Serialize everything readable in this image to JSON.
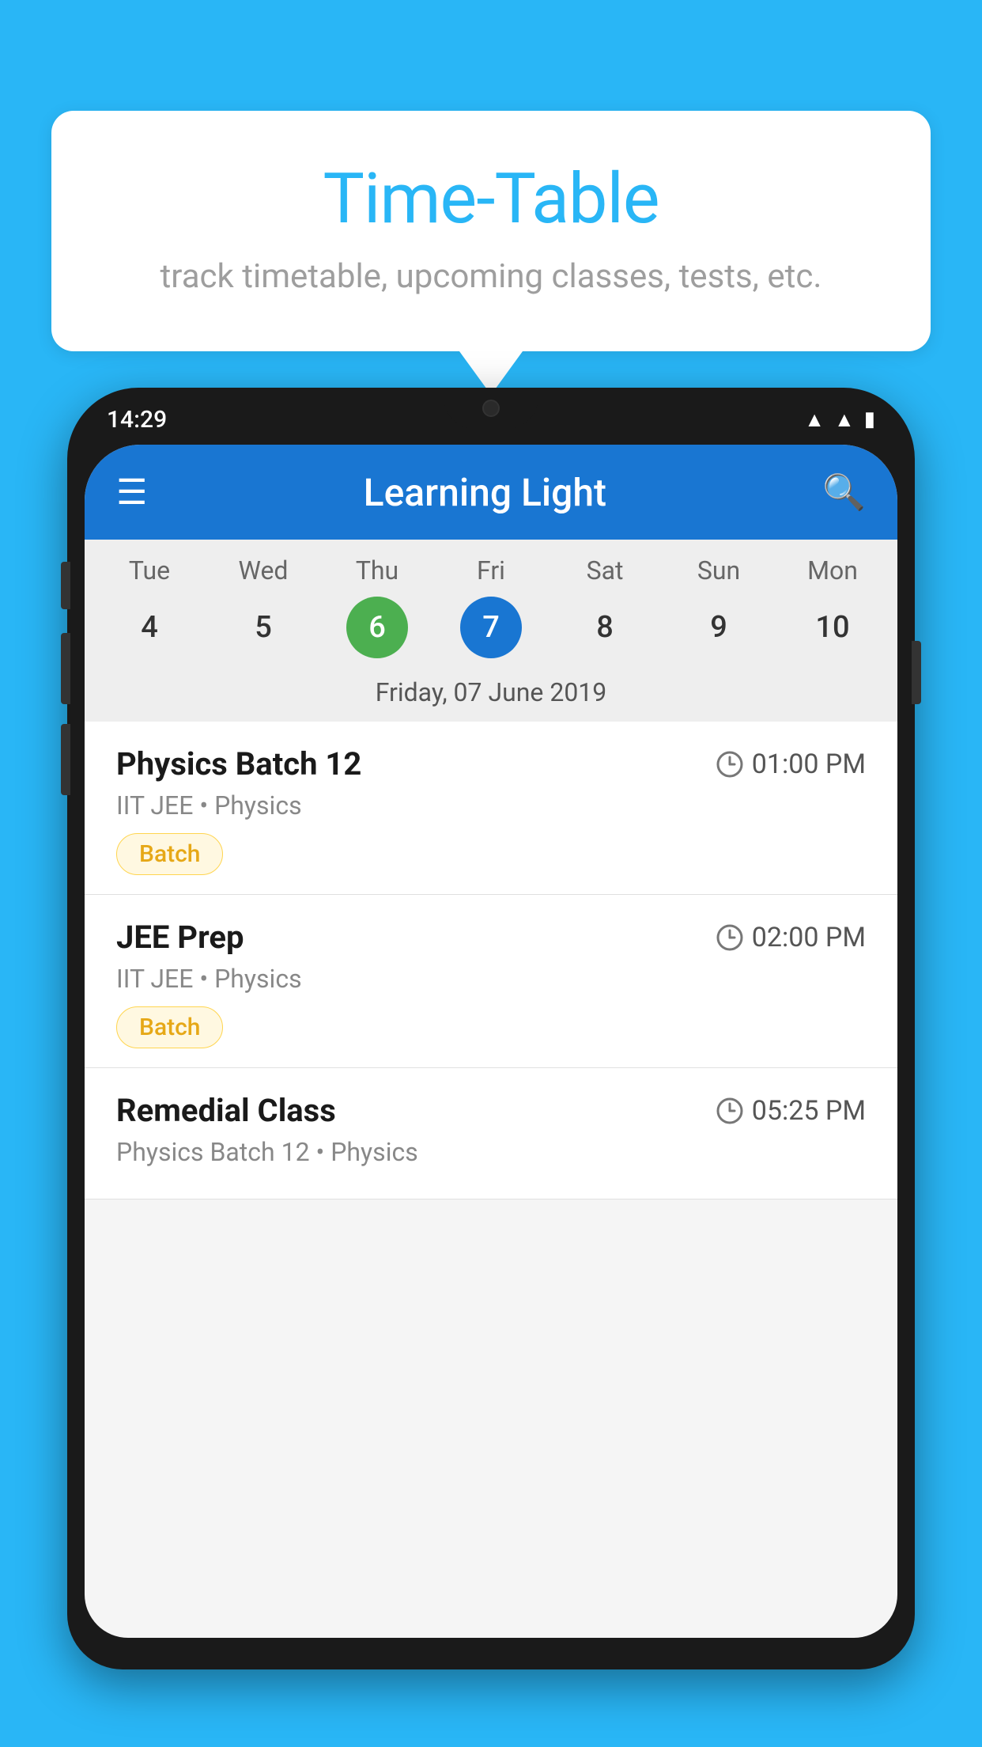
{
  "background_color": "#29B6F6",
  "speech_bubble": {
    "title": "Time-Table",
    "subtitle": "track timetable, upcoming classes, tests, etc."
  },
  "phone": {
    "status_bar": {
      "time": "14:29"
    },
    "app_bar": {
      "title": "Learning Light"
    },
    "calendar": {
      "days": [
        {
          "name": "Tue",
          "num": "4",
          "state": "normal"
        },
        {
          "name": "Wed",
          "num": "5",
          "state": "normal"
        },
        {
          "name": "Thu",
          "num": "6",
          "state": "today"
        },
        {
          "name": "Fri",
          "num": "7",
          "state": "selected"
        },
        {
          "name": "Sat",
          "num": "8",
          "state": "normal"
        },
        {
          "name": "Sun",
          "num": "9",
          "state": "normal"
        },
        {
          "name": "Mon",
          "num": "10",
          "state": "normal"
        }
      ],
      "selected_date_label": "Friday, 07 June 2019"
    },
    "schedule": [
      {
        "title": "Physics Batch 12",
        "time": "01:00 PM",
        "subtitle": "IIT JEE • Physics",
        "tag": "Batch"
      },
      {
        "title": "JEE Prep",
        "time": "02:00 PM",
        "subtitle": "IIT JEE • Physics",
        "tag": "Batch"
      },
      {
        "title": "Remedial Class",
        "time": "05:25 PM",
        "subtitle": "Physics Batch 12 • Physics",
        "tag": ""
      }
    ]
  }
}
